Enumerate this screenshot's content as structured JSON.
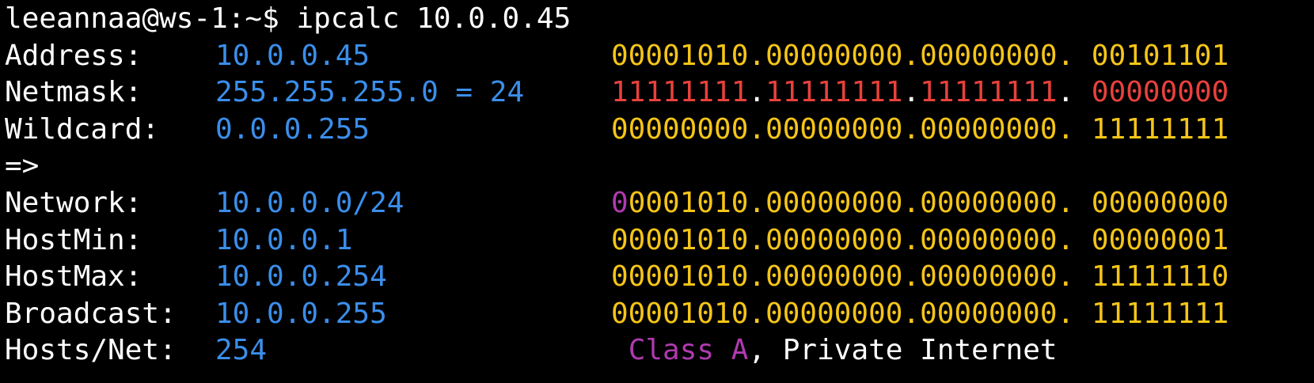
{
  "colors": {
    "background": "#000000",
    "text": "#ffffff",
    "value": "#3b8eea",
    "binary": "#f5c518",
    "netmask_binary": "#e8413c",
    "class": "#b03ab0"
  },
  "prompt": "leeannaa@ws-1:~$ ipcalc 10.0.0.45",
  "rows": {
    "address": {
      "label": "Address:",
      "value": "10.0.0.45",
      "bin_main": "00001010.00000000.00000000.",
      "bin_last": "00101101"
    },
    "netmask": {
      "label": "Netmask:",
      "value": "255.255.255.0 = 24",
      "bin_a": "11111111",
      "bin_b": "11111111",
      "bin_c": "11111111",
      "bin_last": "00000000"
    },
    "wildcard": {
      "label": "Wildcard:",
      "value": "0.0.0.255",
      "bin_main": "00000000.00000000.00000000.",
      "bin_last": "11111111"
    },
    "arrow": "=>",
    "network": {
      "label": "Network:",
      "value": "10.0.0.0/24",
      "bin_first_bit": "0",
      "bin_main": "0001010.00000000.00000000.",
      "bin_last": "00000000"
    },
    "hostmin": {
      "label": "HostMin:",
      "value": "10.0.0.1",
      "bin_main": "00001010.00000000.00000000.",
      "bin_last": "00000001"
    },
    "hostmax": {
      "label": "HostMax:",
      "value": "10.0.0.254",
      "bin_main": "00001010.00000000.00000000.",
      "bin_last": "11111110"
    },
    "broadcast": {
      "label": "Broadcast:",
      "value": "10.0.0.255",
      "bin_main": "00001010.00000000.00000000.",
      "bin_last": "11111111"
    },
    "hosts": {
      "label": "Hosts/Net:",
      "value": "254",
      "class_label": "Class A",
      "class_suffix": ", Private Internet"
    }
  }
}
